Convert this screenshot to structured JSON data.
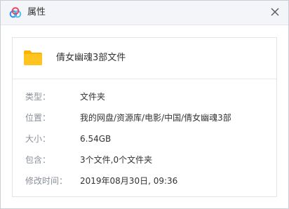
{
  "window": {
    "title": "属性",
    "app_icon": "baidu-netdisk-cloud-icon",
    "close_icon": "close-icon"
  },
  "file": {
    "icon": "folder-icon",
    "icon_color": "#ffc41f",
    "name": "倩女幽魂3部文件"
  },
  "properties": [
    {
      "label": "类型：",
      "value": "文件夹"
    },
    {
      "label": "位置：",
      "value": "我的网盘/资源库/电影/中国/倩女幽魂3部"
    },
    {
      "label": "大小：",
      "value": "6.54GB"
    },
    {
      "label": "包含：",
      "value": "3个文件,0个文件夹"
    },
    {
      "label": "修改时间：",
      "value": "2019年08月30日, 09:36"
    }
  ]
}
